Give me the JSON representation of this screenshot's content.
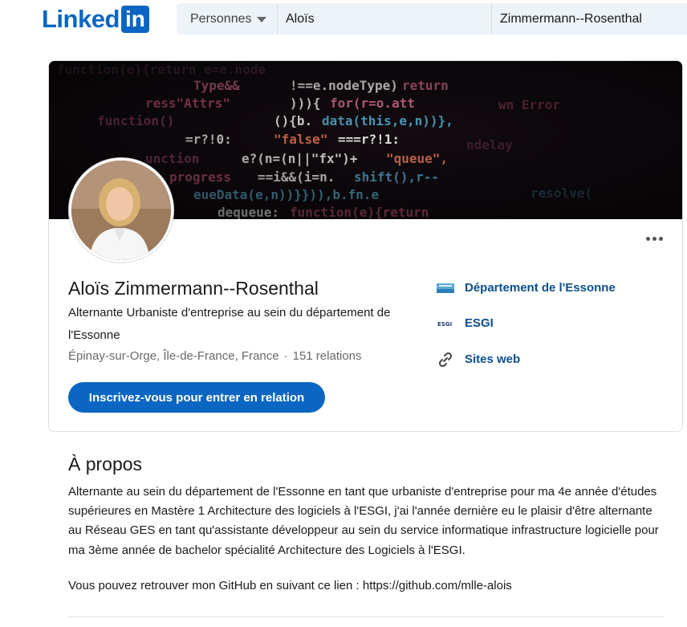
{
  "header": {
    "logo_word": "Linked",
    "logo_box": "in",
    "search_category": "Personnes",
    "first_name_value": "Aloïs",
    "last_name_value": "Zimmermann--Rosenthal"
  },
  "profile": {
    "name": "Aloïs Zimmermann--Rosenthal",
    "headline": "Alternante Urbaniste d'entreprise au sein du département de l'Essonne",
    "location": "Épinay-sur-Orge, Île-de-France, France",
    "separator": "·",
    "connections": "151 relations",
    "cta_label": "Inscrivez-vous pour entrer en relation",
    "side_links": [
      {
        "label": "Département de l'Essonne",
        "icon": "essonne-logo-icon"
      },
      {
        "label": "ESGI",
        "icon": "esgi-logo-icon"
      },
      {
        "label": "Sites web",
        "icon": "link-icon"
      }
    ],
    "more_icon": "more-horizontal-icon"
  },
  "about": {
    "title": "À propos",
    "body": "Alternante au sein du département de l'Essonne en tant que urbaniste d'entreprise pour ma 4e année d'études supérieures en Mastère 1 Architecture des logiciels à l'ESGI, j'ai l'année dernière eu le plaisir d'être alternante au Réseau GES en tant qu'assistante développeur au sein du service informatique infrastructure logicielle pour ma 3ème année de bachelor spécialité Architecture des Logiciels à l'ESGI.",
    "github_line": "Vous pouvez retrouver mon GitHub en suivant ce lien : https://github.com/mlle-alois"
  },
  "colors": {
    "brand": "#0a66c2",
    "link": "#0a4f8f",
    "background": "#ffffff"
  }
}
